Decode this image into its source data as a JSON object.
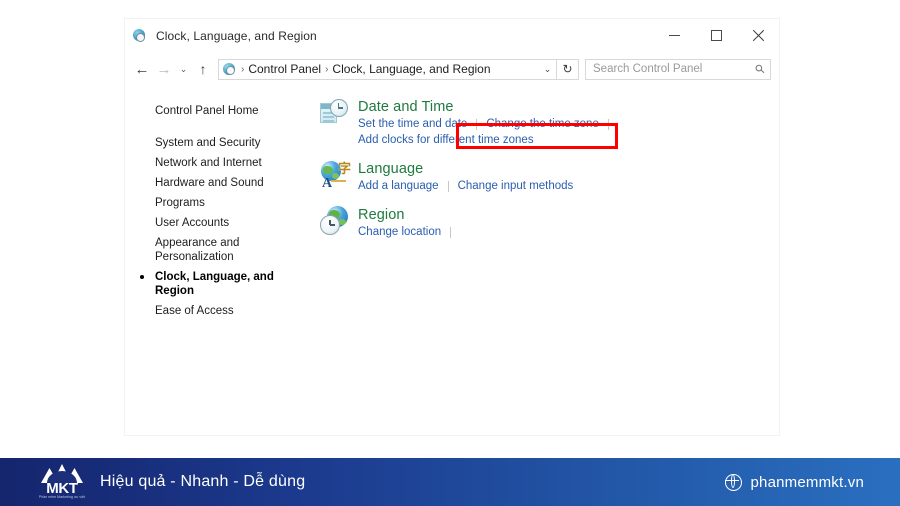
{
  "window": {
    "title": "Clock, Language, and Region",
    "title_icon": "clock-globe-icon",
    "controls": {
      "minimize": "minimize-button",
      "maximize": "maximize-button",
      "close": "close-button"
    }
  },
  "navbar": {
    "back": "←",
    "forward": "→",
    "recent": "⌄",
    "up": "↑",
    "breadcrumbs": [
      "Control Panel",
      "Clock, Language, and Region"
    ],
    "separator": "›",
    "dropdown": "⌄",
    "refresh": "↻",
    "search_placeholder": "Search Control Panel",
    "search_value": "",
    "search_icon": "⚲"
  },
  "sidebar": {
    "home": "Control Panel Home",
    "items": [
      {
        "label": "System and Security",
        "current": false
      },
      {
        "label": "Network and Internet",
        "current": false
      },
      {
        "label": "Hardware and Sound",
        "current": false
      },
      {
        "label": "Programs",
        "current": false
      },
      {
        "label": "User Accounts",
        "current": false
      },
      {
        "label": "Appearance and\nPersonalization",
        "current": false
      },
      {
        "label": "Clock, Language, and Region",
        "current": true
      },
      {
        "label": "Ease of Access",
        "current": false
      }
    ]
  },
  "content": {
    "categories": [
      {
        "icon": "date-and-time-icon",
        "title": "Date and Time",
        "links_row1": [
          "Set the time and date",
          "Change the time zone"
        ],
        "links_row2": [
          "Add clocks for different time zones"
        ]
      },
      {
        "icon": "language-icon",
        "title": "Language",
        "links_row1": [
          "Add a language",
          "Change input methods"
        ],
        "links_row2": []
      },
      {
        "icon": "region-icon",
        "title": "Region",
        "links_row1": [
          "Change location",
          ""
        ],
        "links_row2": []
      }
    ]
  },
  "annotation": {
    "highlight_color": "#ff0000",
    "highlight_target": "Date and Time"
  },
  "banner": {
    "logo_text": "MKT",
    "logo_tagline": "Phần mềm Marketing ưu việt",
    "slogan": "Hiệu quả - Nhanh - Dễ dùng",
    "website": "phanmemmkt.vn",
    "globe_icon": "globe-icon",
    "background_start": "#15256e",
    "background_end": "#2a6fc0"
  }
}
